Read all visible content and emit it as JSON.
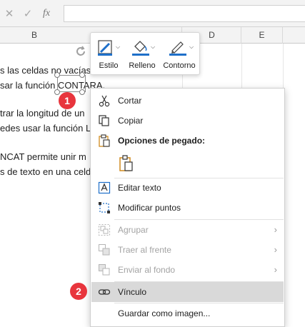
{
  "formula_bar": {
    "cancel_glyph": "✕",
    "enter_glyph": "✓",
    "fx_label": "fx",
    "value": ""
  },
  "columns": [
    {
      "label": "B"
    },
    {
      "label": "D"
    },
    {
      "label": "E"
    }
  ],
  "sheet_lines": [
    "s las celdas no vacías",
    "sar la función CONTARA.",
    "trar la longitud de un",
    "edes usar la función L",
    "NCAT permite unir m",
    "s de texto en una celd"
  ],
  "mini_toolbar": [
    {
      "label": "Estilo",
      "icon": "shape-style-icon"
    },
    {
      "label": "Relleno",
      "icon": "paint-bucket-icon"
    },
    {
      "label": "Contorno",
      "icon": "pen-outline-icon"
    }
  ],
  "callouts": [
    "1",
    "2"
  ],
  "context_menu": {
    "cut": {
      "label": "Cortar",
      "icon": "scissors-icon"
    },
    "copy": {
      "label": "Copiar",
      "icon": "copy-icon"
    },
    "paste_options": {
      "label": "Opciones de pegado:",
      "icon": "clipboard-icon"
    },
    "paste_button": {
      "icon": "paste-clipboard-icon"
    },
    "edit_text": {
      "label": "Editar texto",
      "icon": "edit-text-icon"
    },
    "edit_points": {
      "label": "Modificar puntos",
      "icon": "edit-points-icon"
    },
    "group": {
      "label": "Agrupar",
      "icon": "group-icon",
      "disabled": true
    },
    "bring_front": {
      "label": "Traer al frente",
      "icon": "bring-front-icon",
      "disabled": true
    },
    "send_back": {
      "label": "Enviar al fondo",
      "icon": "send-back-icon",
      "disabled": true
    },
    "link": {
      "label": "Vínculo",
      "icon": "link-icon",
      "highlighted": true
    },
    "save_image": {
      "label": "Guardar como imagen...",
      "icon": ""
    }
  },
  "colors": {
    "accent_blue": "#1e6fc9",
    "callout_red": "#e8353d",
    "highlight_gray": "#d9d9d9",
    "paste_orange": "#d08a1e"
  }
}
